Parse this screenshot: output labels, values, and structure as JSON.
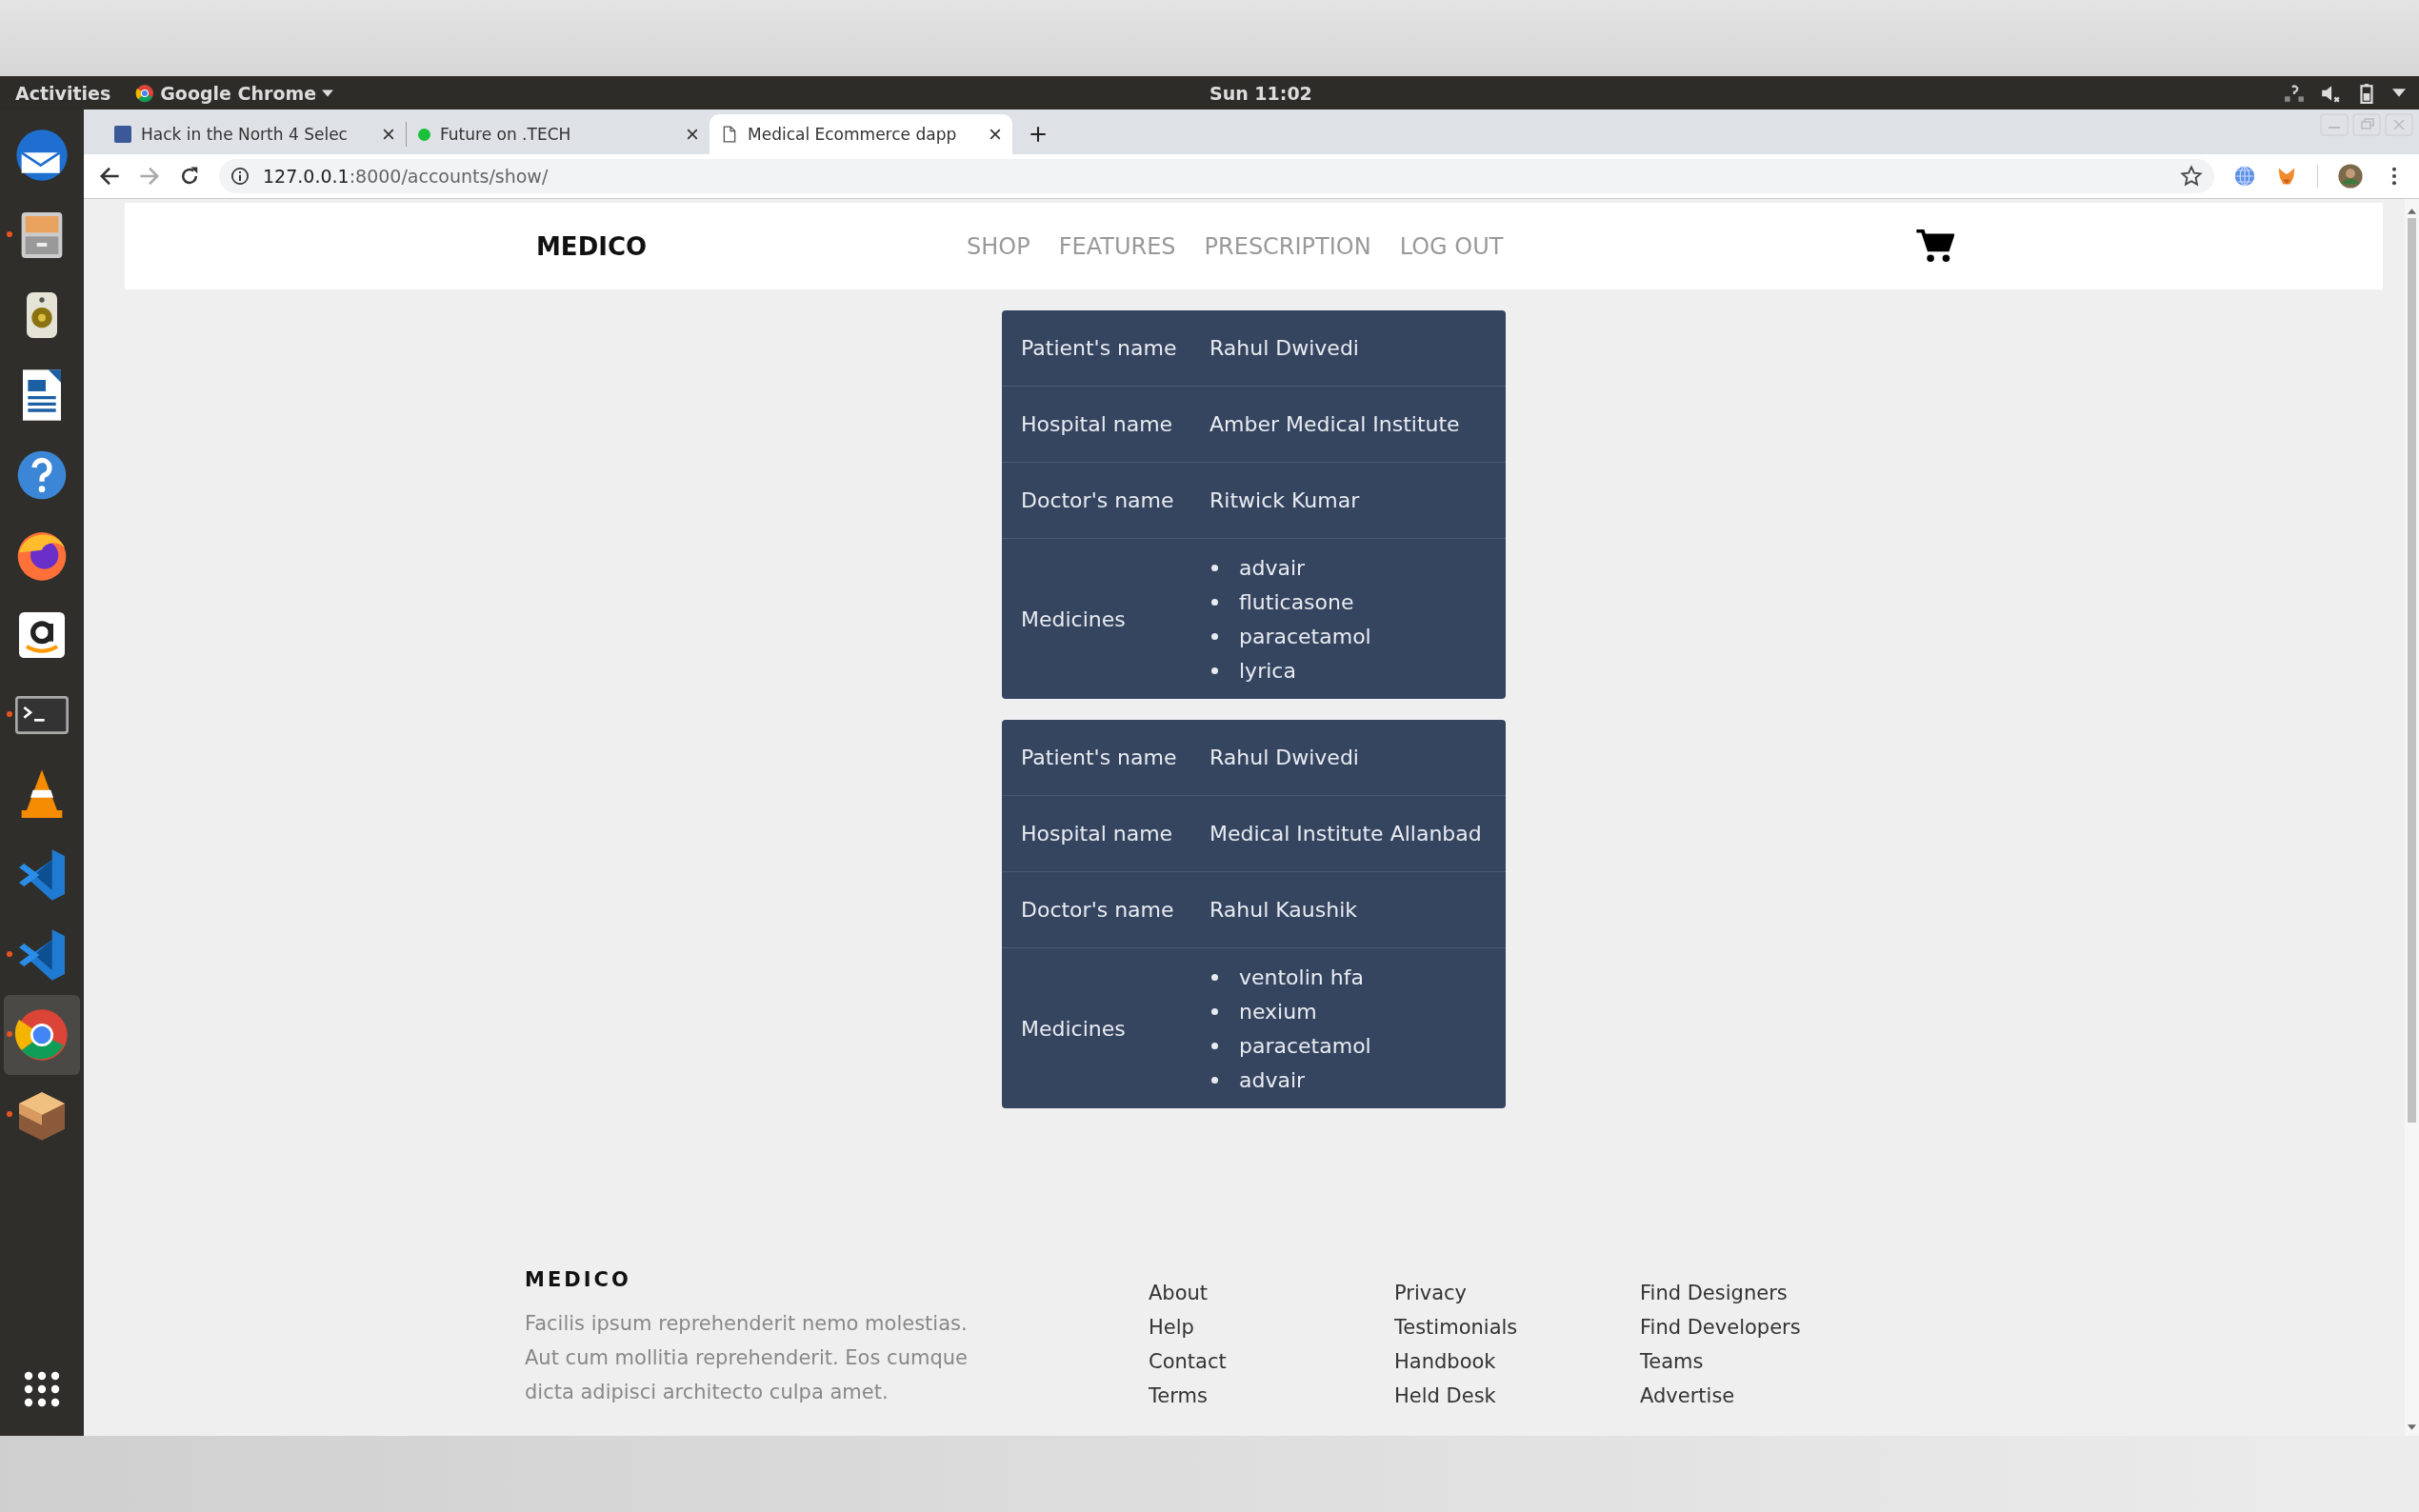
{
  "topbar": {
    "activities": "Activities",
    "app_menu": "Google Chrome",
    "clock": "Sun 11:02"
  },
  "dock": [
    {
      "kind": "mail",
      "running": false,
      "selected": false
    },
    {
      "kind": "files",
      "running": true,
      "selected": false
    },
    {
      "kind": "speaker",
      "running": false,
      "selected": false
    },
    {
      "kind": "writer",
      "running": false,
      "selected": false
    },
    {
      "kind": "help",
      "running": false,
      "selected": false
    },
    {
      "kind": "firefox",
      "running": false,
      "selected": false
    },
    {
      "kind": "amazon",
      "running": false,
      "selected": false
    },
    {
      "kind": "terminal",
      "running": true,
      "selected": false
    },
    {
      "kind": "vlc",
      "running": false,
      "selected": false
    },
    {
      "kind": "code",
      "running": false,
      "selected": false
    },
    {
      "kind": "code",
      "running": true,
      "selected": false
    },
    {
      "kind": "chrome",
      "running": true,
      "selected": true
    },
    {
      "kind": "box",
      "running": true,
      "selected": false
    }
  ],
  "browser": {
    "tabs": [
      {
        "title": "Hack in the North 4 Selec",
        "kind": "facebook",
        "selected": false
      },
      {
        "title": "Future on .TECH",
        "kind": "dot",
        "selected": false
      },
      {
        "title": "Medical Ecommerce dapp",
        "kind": "page",
        "selected": true
      }
    ],
    "url_host": "127.0.0.1",
    "url_path": ":8000/accounts/show/"
  },
  "navbar": {
    "brand": "MEDICO",
    "links": [
      "SHOP",
      "FEATURES",
      "PRESCRIPTION",
      "LOG OUT"
    ]
  },
  "prescriptions": [
    {
      "rows": [
        {
          "kind": "text",
          "label": "Patient's name",
          "value": "Rahul Dwivedi"
        },
        {
          "kind": "text",
          "label": "Hospital name",
          "value": "Amber Medical Institute"
        },
        {
          "kind": "text",
          "label": "Doctor's name",
          "value": "Ritwick Kumar"
        },
        {
          "kind": "list",
          "label": "Medicines",
          "items": [
            "advair",
            "fluticasone",
            "paracetamol",
            "lyrica"
          ]
        }
      ]
    },
    {
      "rows": [
        {
          "kind": "text",
          "label": "Patient's name",
          "value": "Rahul Dwivedi"
        },
        {
          "kind": "text",
          "label": "Hospital name",
          "value": "Medical Institute Allanbad"
        },
        {
          "kind": "text",
          "label": "Doctor's name",
          "value": "Rahul Kaushik"
        },
        {
          "kind": "list",
          "label": "Medicines",
          "items": [
            "ventolin hfa",
            "nexium",
            "paracetamol",
            "advair"
          ]
        }
      ]
    }
  ],
  "footer": {
    "brand": "MEDICO",
    "blurb": "Facilis ipsum reprehenderit nemo molestias. Aut cum mollitia reprehenderit. Eos cumque dicta adipisci architecto culpa amet.",
    "link_columns": [
      [
        "About",
        "Help",
        "Contact",
        "Terms"
      ],
      [
        "Privacy",
        "Testimonials",
        "Handbook",
        "Held Desk"
      ],
      [
        "Find Designers",
        "Find Developers",
        "Teams",
        "Advertise"
      ]
    ]
  }
}
